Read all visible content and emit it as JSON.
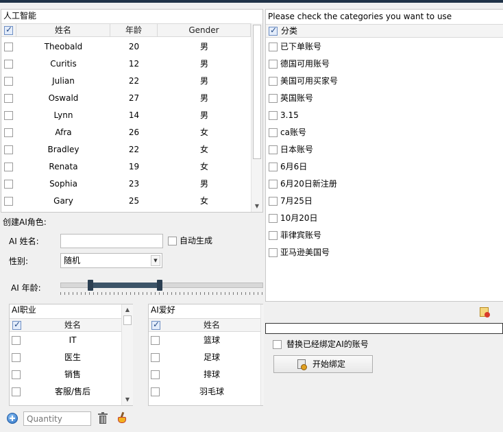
{
  "left_table": {
    "title": "人工智能",
    "headers": {
      "name": "姓名",
      "age": "年龄",
      "gender": "Gender"
    },
    "rows": [
      {
        "name": "Theobald",
        "age": "20",
        "gender": "男"
      },
      {
        "name": "Curitis",
        "age": "12",
        "gender": "男"
      },
      {
        "name": "Julian",
        "age": "22",
        "gender": "男"
      },
      {
        "name": "Oswald",
        "age": "27",
        "gender": "男"
      },
      {
        "name": "Lynn",
        "age": "14",
        "gender": "男"
      },
      {
        "name": "Afra",
        "age": "26",
        "gender": "女"
      },
      {
        "name": "Bradley",
        "age": "22",
        "gender": "女"
      },
      {
        "name": "Renata",
        "age": "19",
        "gender": "女"
      },
      {
        "name": "Sophia",
        "age": "23",
        "gender": "男"
      },
      {
        "name": "Gary",
        "age": "25",
        "gender": "女"
      }
    ]
  },
  "create": {
    "title": "创建AI角色:",
    "name_label": "AI 姓名:",
    "name_value": "",
    "auto_label": "自动生成",
    "gender_label": "性别:",
    "gender_value": "随机",
    "age_label": "AI 年龄:"
  },
  "job_list": {
    "title": "AI职业",
    "header": "姓名",
    "items": [
      "IT",
      "医生",
      "销售",
      "客服/售后"
    ]
  },
  "hobby_list": {
    "title": "AI爱好",
    "header": "姓名",
    "items": [
      "篮球",
      "足球",
      "排球",
      "羽毛球"
    ]
  },
  "bottom_bar": {
    "quantity_placeholder": "Quantity"
  },
  "categories": {
    "prompt": "Please check the categories you want to use",
    "header": "分类",
    "items": [
      "已下单账号",
      "德国可用账号",
      "美国可用买家号",
      "英国账号",
      "3.15",
      "ca账号",
      "日本账号",
      "6月6日",
      "6月20日新注册",
      "7月25日",
      "10月20日",
      "菲律宾账号",
      "亚马逊美国号"
    ]
  },
  "bind": {
    "replace_label": "替换已经绑定AI的账号",
    "start_label": "开始绑定"
  },
  "colors": {
    "accent": "#1f3247",
    "slider": "#3c5468"
  }
}
